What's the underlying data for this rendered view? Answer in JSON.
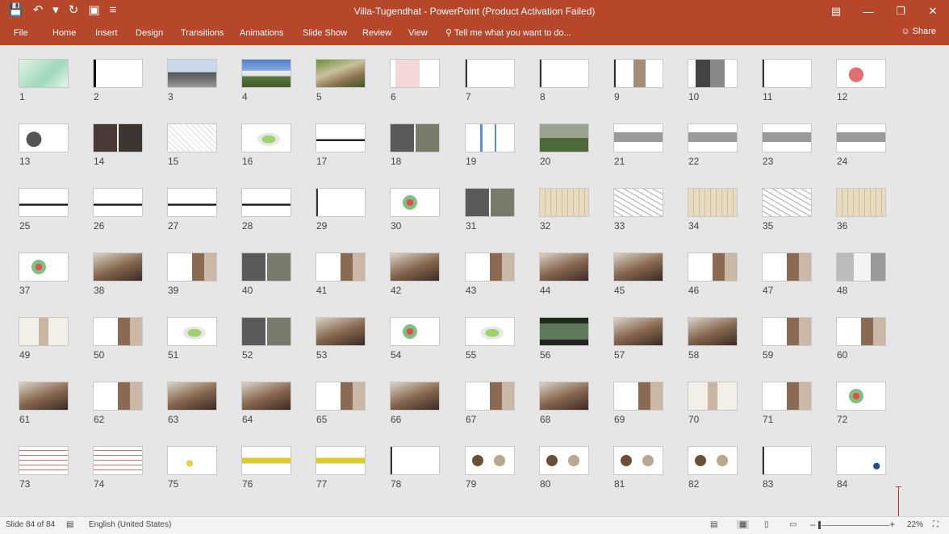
{
  "titlebar": {
    "title": "Villa-Tugendhat - PowerPoint (Product Activation Failed)",
    "qat": [
      {
        "name": "save-icon",
        "glyph": "💾"
      },
      {
        "name": "undo-icon",
        "glyph": "↶"
      },
      {
        "name": "undo-dropdown-icon",
        "glyph": "▾"
      },
      {
        "name": "redo-icon",
        "glyph": "↻"
      },
      {
        "name": "present-icon",
        "glyph": "▣"
      },
      {
        "name": "customize-qat-icon",
        "glyph": "≡"
      }
    ],
    "window_controls": [
      {
        "name": "ribbon-display-icon",
        "glyph": "▤"
      },
      {
        "name": "minimize-icon",
        "glyph": "—"
      },
      {
        "name": "restore-icon",
        "glyph": "❐"
      },
      {
        "name": "close-icon",
        "glyph": "✕"
      }
    ]
  },
  "ribbon": {
    "tabs": [
      "File",
      "Home",
      "Insert",
      "Design",
      "Transitions",
      "Animations",
      "Slide Show",
      "Review",
      "View"
    ],
    "tell_me": "Tell me what you want to do...",
    "share": "Share",
    "accent": "#b7472a"
  },
  "slides": [
    {
      "n": "1",
      "style": "drawing-green"
    },
    {
      "n": "2",
      "style": "text-sketch"
    },
    {
      "n": "3",
      "style": "photo-house"
    },
    {
      "n": "4",
      "style": "photo-house-blue"
    },
    {
      "n": "5",
      "style": "photo-trees"
    },
    {
      "n": "6",
      "style": "portrait"
    },
    {
      "n": "7",
      "style": "text"
    },
    {
      "n": "8",
      "style": "text"
    },
    {
      "n": "9",
      "style": "text-photo"
    },
    {
      "n": "10",
      "style": "text-bw"
    },
    {
      "n": "11",
      "style": "text"
    },
    {
      "n": "12",
      "style": "map-red"
    },
    {
      "n": "13",
      "style": "map-red-border"
    },
    {
      "n": "14",
      "style": "photos-dark"
    },
    {
      "n": "15",
      "style": "sketch"
    },
    {
      "n": "16",
      "style": "model-green"
    },
    {
      "n": "17",
      "style": "section"
    },
    {
      "n": "18",
      "style": "photos-grid"
    },
    {
      "n": "19",
      "style": "sketch-blue"
    },
    {
      "n": "20",
      "style": "photos-green"
    },
    {
      "n": "21",
      "style": "render"
    },
    {
      "n": "22",
      "style": "render"
    },
    {
      "n": "23",
      "style": "render"
    },
    {
      "n": "24",
      "style": "render"
    },
    {
      "n": "25",
      "style": "section"
    },
    {
      "n": "26",
      "style": "section"
    },
    {
      "n": "27",
      "style": "section"
    },
    {
      "n": "28",
      "style": "section"
    },
    {
      "n": "29",
      "style": "text"
    },
    {
      "n": "30",
      "style": "diagram-color"
    },
    {
      "n": "31",
      "style": "photos-grid"
    },
    {
      "n": "32",
      "style": "plan-beige"
    },
    {
      "n": "33",
      "style": "plan"
    },
    {
      "n": "34",
      "style": "plan-beige"
    },
    {
      "n": "35",
      "style": "plan"
    },
    {
      "n": "36",
      "style": "plan-beige"
    },
    {
      "n": "37",
      "style": "diagram-color"
    },
    {
      "n": "38",
      "style": "photo-interior"
    },
    {
      "n": "39",
      "style": "plan-photo"
    },
    {
      "n": "40",
      "style": "photos-grid"
    },
    {
      "n": "41",
      "style": "plan-photo"
    },
    {
      "n": "42",
      "style": "photo-interior"
    },
    {
      "n": "43",
      "style": "plan-photo"
    },
    {
      "n": "44",
      "style": "photo-interior"
    },
    {
      "n": "45",
      "style": "photo-interior"
    },
    {
      "n": "46",
      "style": "plan-photo"
    },
    {
      "n": "47",
      "style": "plan-photo"
    },
    {
      "n": "48",
      "style": "photo-window"
    },
    {
      "n": "49",
      "style": "photo-light"
    },
    {
      "n": "50",
      "style": "plan-photo"
    },
    {
      "n": "51",
      "style": "model-green"
    },
    {
      "n": "52",
      "style": "photos-grid"
    },
    {
      "n": "53",
      "style": "photo-interior"
    },
    {
      "n": "54",
      "style": "diagram-color"
    },
    {
      "n": "55",
      "style": "model-green"
    },
    {
      "n": "56",
      "style": "photo-dark-green"
    },
    {
      "n": "57",
      "style": "photo-interior"
    },
    {
      "n": "58",
      "style": "photo-interior"
    },
    {
      "n": "59",
      "style": "plan-photo"
    },
    {
      "n": "60",
      "style": "plan-photo"
    },
    {
      "n": "61",
      "style": "photo-interior"
    },
    {
      "n": "62",
      "style": "plan-photo"
    },
    {
      "n": "63",
      "style": "photo-interior"
    },
    {
      "n": "64",
      "style": "photo-interior"
    },
    {
      "n": "65",
      "style": "plan-photo"
    },
    {
      "n": "66",
      "style": "photo-interior"
    },
    {
      "n": "67",
      "style": "plan-photo"
    },
    {
      "n": "68",
      "style": "photo-interior"
    },
    {
      "n": "69",
      "style": "plan-photo"
    },
    {
      "n": "70",
      "style": "photo-light"
    },
    {
      "n": "71",
      "style": "plan-photo"
    },
    {
      "n": "72",
      "style": "diagram-color"
    },
    {
      "n": "73",
      "style": "plan-red"
    },
    {
      "n": "74",
      "style": "plan-red"
    },
    {
      "n": "75",
      "style": "text-yellow"
    },
    {
      "n": "76",
      "style": "section-yellow"
    },
    {
      "n": "77",
      "style": "section-yellow"
    },
    {
      "n": "78",
      "style": "text"
    },
    {
      "n": "79",
      "style": "materials"
    },
    {
      "n": "80",
      "style": "materials"
    },
    {
      "n": "81",
      "style": "materials"
    },
    {
      "n": "82",
      "style": "materials"
    },
    {
      "n": "83",
      "style": "text"
    },
    {
      "n": "84",
      "style": "text-logo"
    }
  ],
  "statusbar": {
    "slide_info": "Slide 84 of 84",
    "language": "English (United States)",
    "zoom_label": "22%",
    "zoom_minus": "–",
    "zoom_plus": "+",
    "zoom_level": 22
  }
}
